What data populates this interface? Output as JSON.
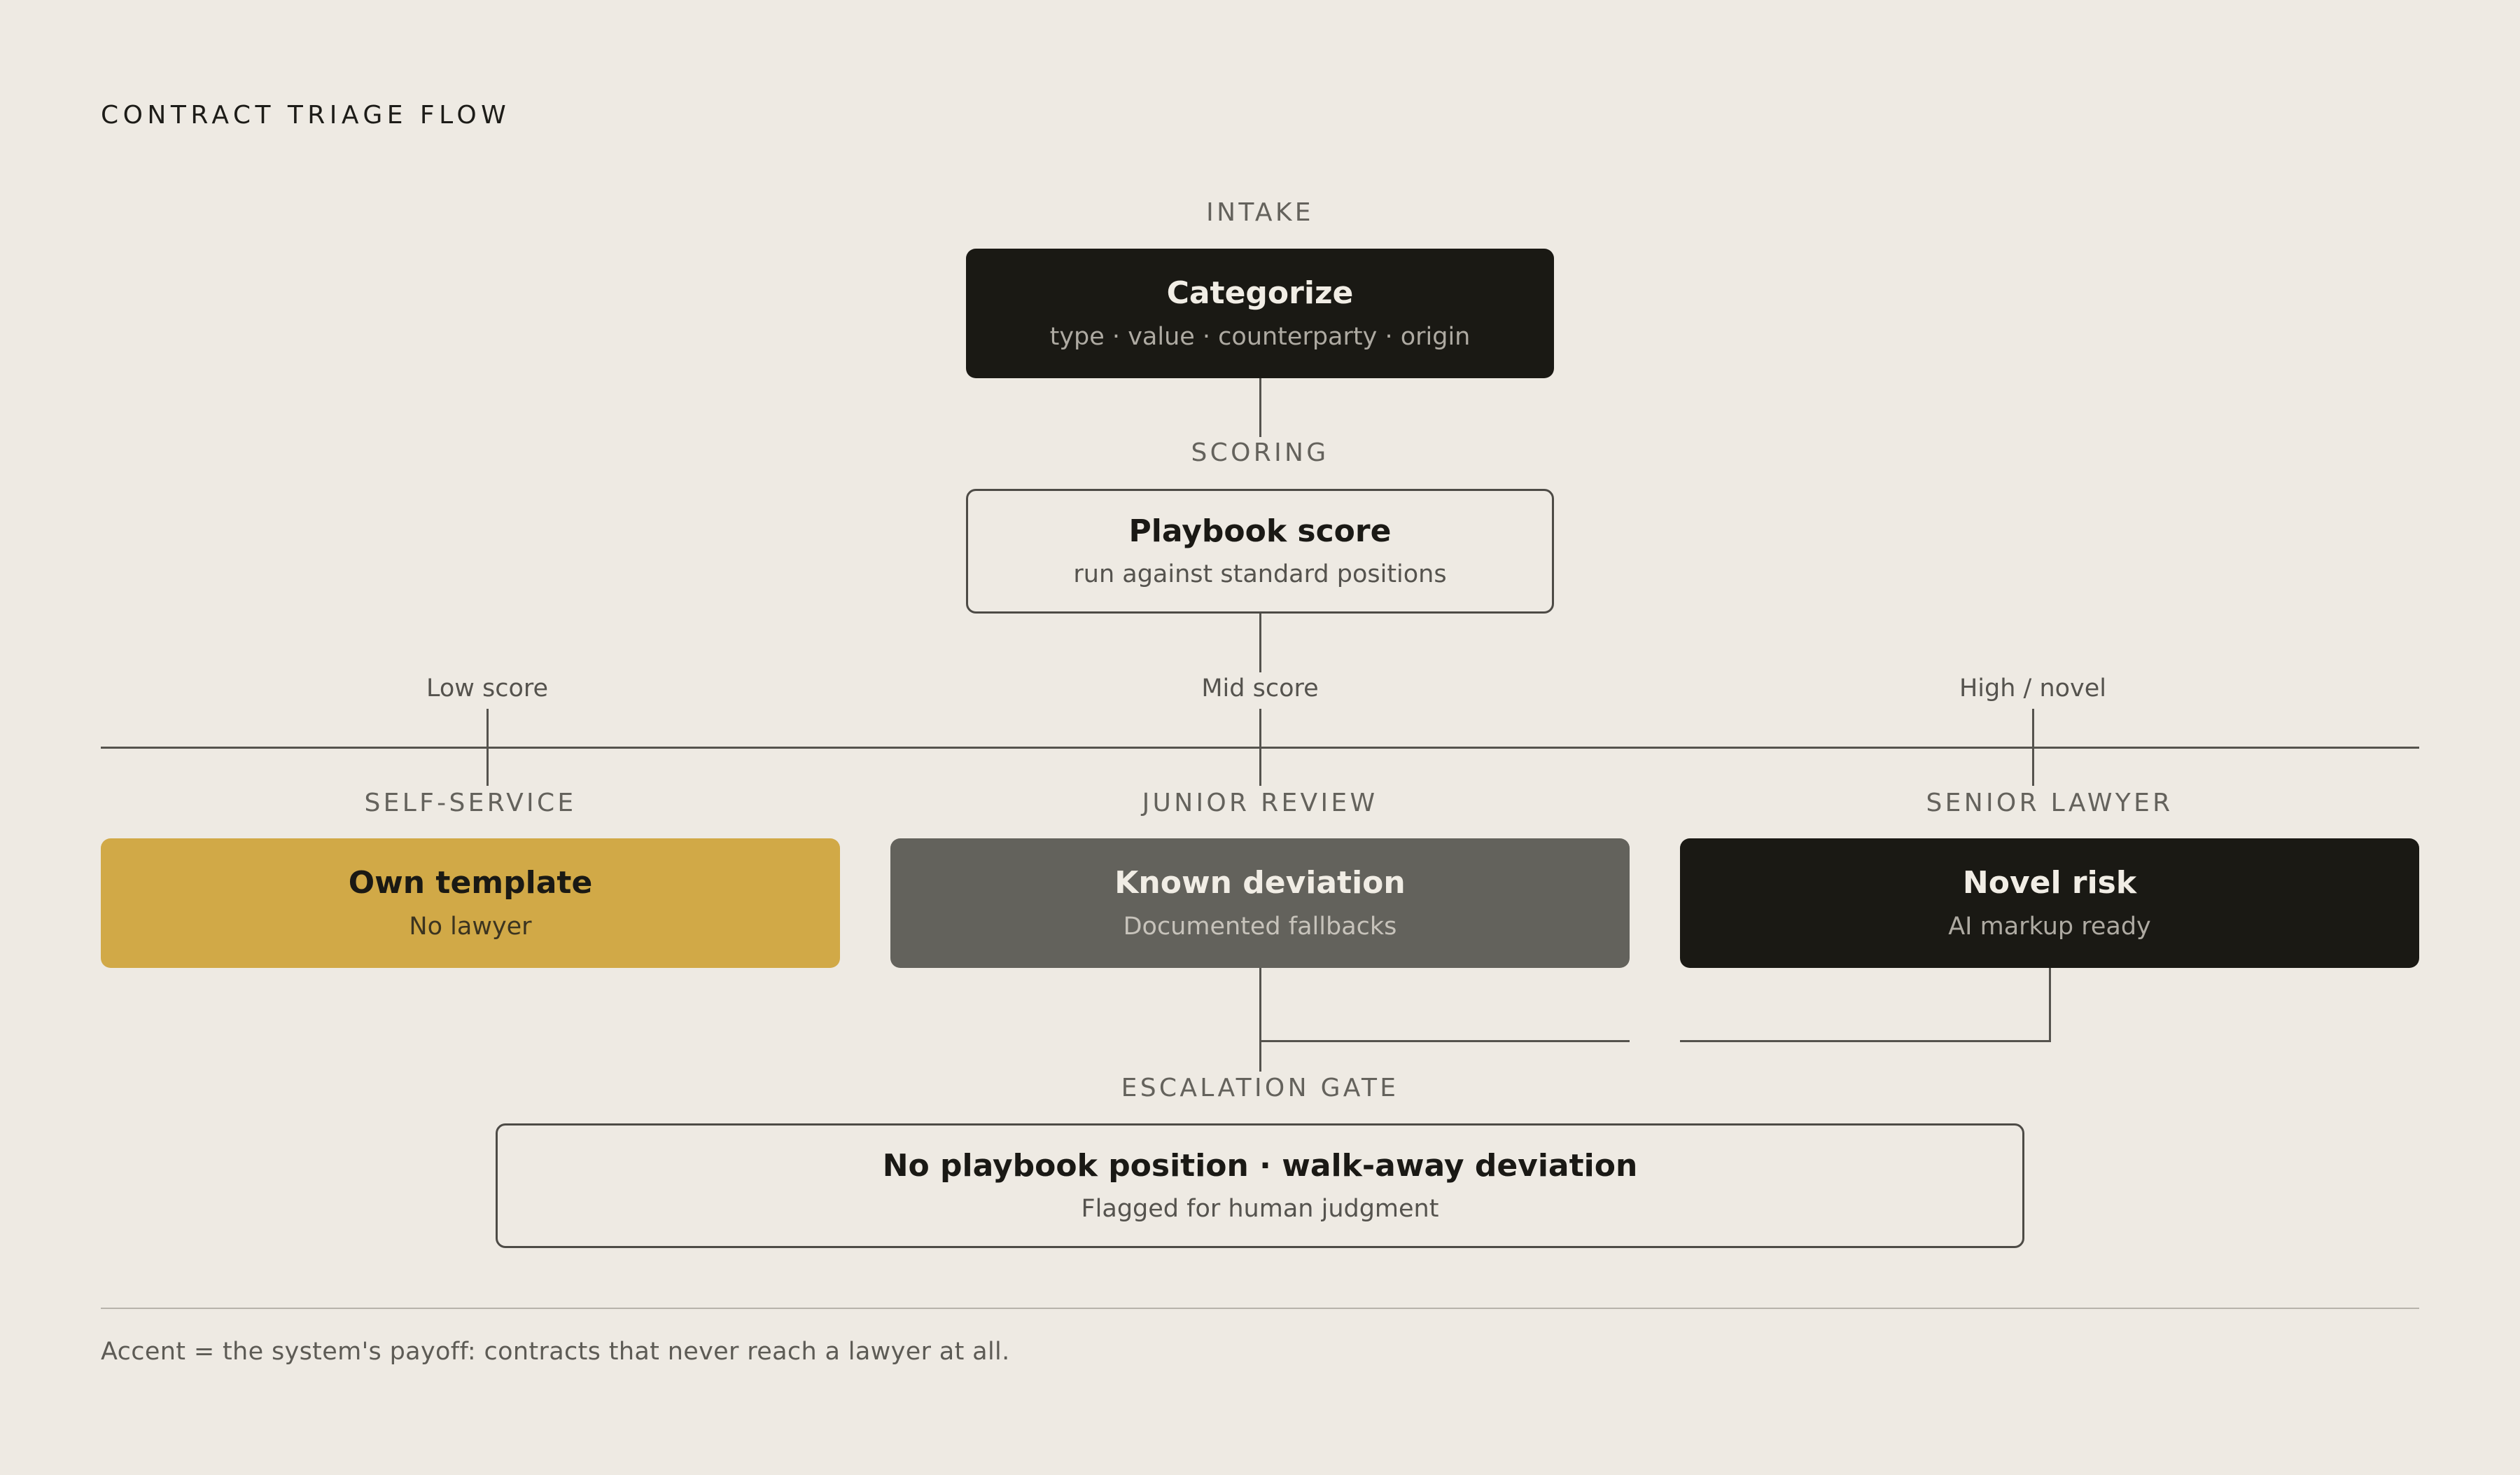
{
  "title": "CONTRACT TRIAGE FLOW",
  "stages": {
    "intake": "INTAKE",
    "scoring": "SCORING",
    "self_service": "SELF-SERVICE",
    "junior_review": "JUNIOR REVIEW",
    "senior_lawyer": "SENIOR LAWYER",
    "escalation_gate": "ESCALATION GATE"
  },
  "nodes": {
    "categorize": {
      "title": "Categorize",
      "subtitle": "type · value · counterparty · origin"
    },
    "playbook_score": {
      "title": "Playbook score",
      "subtitle": "run against standard positions"
    },
    "own_template": {
      "title": "Own template",
      "subtitle": "No lawyer"
    },
    "known_deviation": {
      "title": "Known deviation",
      "subtitle": "Documented fallbacks"
    },
    "novel_risk": {
      "title": "Novel risk",
      "subtitle": "AI markup ready"
    },
    "escalation": {
      "title": "No playbook position · walk-away deviation",
      "subtitle": "Flagged for human judgment"
    }
  },
  "branches": {
    "low": "Low score",
    "mid": "Mid score",
    "high": "High / novel"
  },
  "footnote": "Accent = the system's payoff: contracts that never reach a lawyer at all.",
  "colors": {
    "background": "#eeeae3",
    "dark": "#1a1914",
    "accent": "#d1a947",
    "mid_grey": "#63625c",
    "line": "#55534e"
  }
}
